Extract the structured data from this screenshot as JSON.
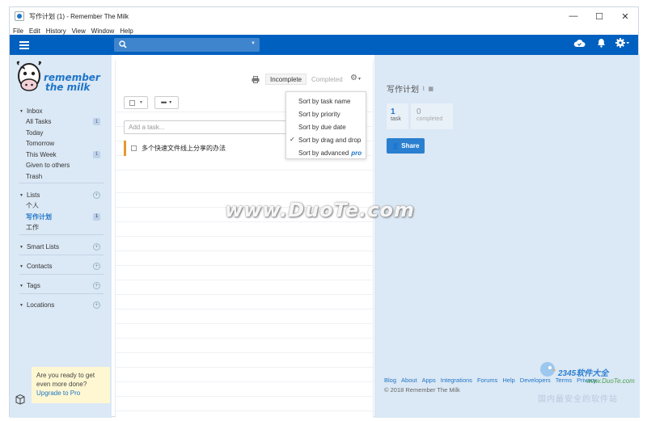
{
  "window": {
    "title": "写作计划 (1) - Remember The Milk",
    "controls": {
      "minimize": "—",
      "maximize": "☐",
      "close": "✕"
    }
  },
  "menu": [
    "File",
    "Edit",
    "History",
    "View",
    "Window",
    "Help"
  ],
  "topbar": {
    "search_icon": "search-icon",
    "icons": [
      "cloud-sync-icon",
      "bell-icon",
      "gear-icon"
    ]
  },
  "logo": {
    "line1": "remember",
    "line2": "the milk"
  },
  "sidebar": {
    "inbox": {
      "label": "Inbox",
      "items": [
        {
          "label": "All Tasks",
          "count": "1"
        },
        {
          "label": "Today",
          "count": ""
        },
        {
          "label": "Tomorrow",
          "count": ""
        },
        {
          "label": "This Week",
          "count": "1"
        },
        {
          "label": "Given to others",
          "count": ""
        },
        {
          "label": "Trash",
          "count": ""
        }
      ]
    },
    "lists": {
      "label": "Lists",
      "items": [
        {
          "label": "个人",
          "count": ""
        },
        {
          "label": "写作计划",
          "count": "1"
        },
        {
          "label": "工作",
          "count": ""
        }
      ]
    },
    "smart_lists": "Smart Lists",
    "contacts": "Contacts",
    "tags": "Tags",
    "locations": "Locations",
    "promo": {
      "line1": "Are you ready to get",
      "line2": "even more done?",
      "link": "Upgrade to Pro"
    }
  },
  "tasks": {
    "tab_incomplete": "Incomplete",
    "tab_completed": "Completed",
    "add_placeholder": "Add a task...",
    "more_label": "•••",
    "items": [
      {
        "name": "多个快速文件线上分享的办法",
        "priority_color": "#e39a2d"
      }
    ]
  },
  "sort_menu": {
    "options": [
      {
        "label": "Sort by task name",
        "checked": false
      },
      {
        "label": "Sort by priority",
        "checked": false
      },
      {
        "label": "Sort by due date",
        "checked": false
      },
      {
        "label": "Sort by drag and drop",
        "checked": true
      },
      {
        "label": "Sort by advanced",
        "checked": false,
        "badge": "pro"
      }
    ]
  },
  "details": {
    "list_name": "写作计划",
    "stats": [
      {
        "value": "1",
        "label": "task"
      },
      {
        "value": "0",
        "label": "completed"
      }
    ],
    "share_label": "Share",
    "footer_links": [
      "Blog",
      "About",
      "Apps",
      "Integrations",
      "Forums",
      "Help",
      "Developers",
      "Terms",
      "Privacy"
    ],
    "copyright": "© 2018 Remember The Milk"
  },
  "watermarks": {
    "center": "www.DuoTe.com",
    "corner_brand": "2345软件大全",
    "corner_url": "www.DuoTe.com",
    "corner_cn": "国内最安全的软件站"
  },
  "colors": {
    "brand_blue": "#0060bf",
    "sidebar_bg": "#dbe8f5",
    "accent": "#1f75c7",
    "priority": "#e39a2d"
  }
}
